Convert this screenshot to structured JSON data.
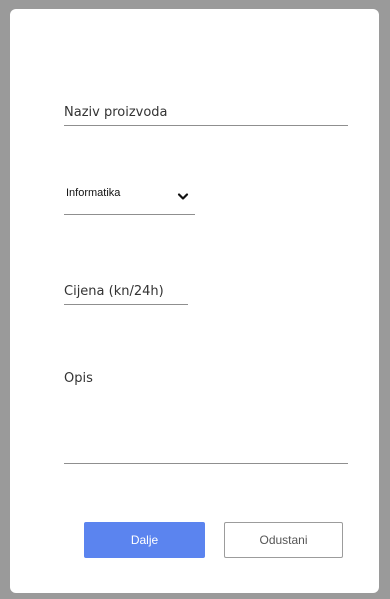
{
  "form": {
    "name_placeholder": "Naziv proizvoda",
    "category": {
      "selected": "Informatika",
      "icon": "chevron-down-icon"
    },
    "price_placeholder": "Cijena (kn/24h)",
    "description_placeholder": "Opis"
  },
  "buttons": {
    "next_label": "Dalje",
    "cancel_label": "Odustani"
  },
  "colors": {
    "primary": "#5b84ef",
    "backdrop": "#9a9a9a"
  }
}
